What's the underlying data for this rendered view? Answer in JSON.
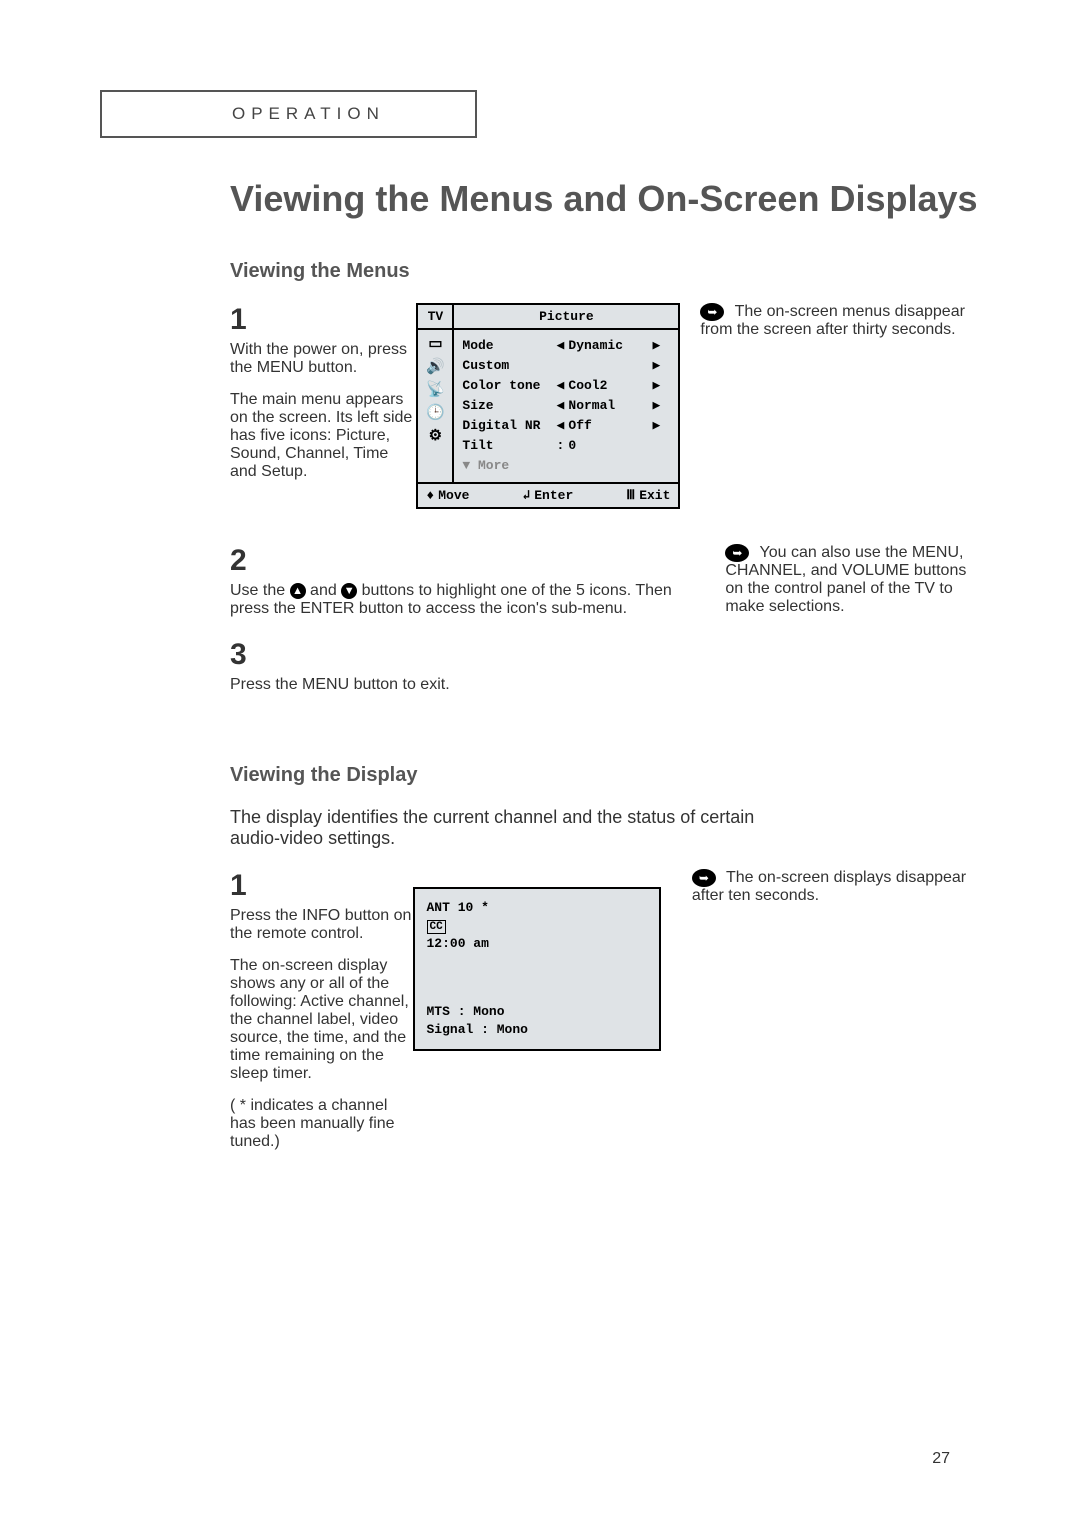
{
  "header": {
    "operation": "OPERATION"
  },
  "title": "Viewing the Menus and On-Screen Displays",
  "menus": {
    "heading": "Viewing the Menus",
    "step1": {
      "num": "1",
      "p1a": "With the power on, press",
      "p1b": "the MENU button.",
      "p2": "The main menu appears on the screen. Its left side has five icons: Picture, Sound, Channel, Time and Setup."
    },
    "step2": {
      "num": "2",
      "textA": "Use the ",
      "textB": " and ",
      "textC": " buttons to highlight one of the 5 icons. Then press the ENTER button to access the icon's sub-menu."
    },
    "step3": {
      "num": "3",
      "text": "Press the MENU button to exit."
    },
    "note1": "The on-screen menus disappear from the screen after thirty seconds.",
    "note2": "You can also use the MENU, CHANNEL, and VOLUME buttons on the control panel of the TV to make selections."
  },
  "osd_picture": {
    "tv": "TV",
    "title": "Picture",
    "rows": [
      {
        "label": "Mode",
        "left": "◀",
        "value": "Dynamic",
        "right": "▶"
      },
      {
        "label": "Custom",
        "left": "",
        "value": "",
        "right": "▶"
      },
      {
        "label": "Color tone",
        "left": "◀",
        "value": "Cool2",
        "right": "▶"
      },
      {
        "label": "Size",
        "left": "◀",
        "value": "Normal",
        "right": "▶"
      },
      {
        "label": "Digital NR",
        "left": "◀",
        "value": "Off",
        "right": "▶"
      },
      {
        "label": "Tilt",
        "left": ":",
        "value": "0",
        "right": ""
      }
    ],
    "more": "▼ More",
    "footer": {
      "move": "Move",
      "enter": "Enter",
      "exit": "Exit"
    }
  },
  "display": {
    "heading": "Viewing the Display",
    "intro": "The display identifies the current channel and the status of certain audio-video settings.",
    "step1": {
      "num": "1",
      "p1": "Press the INFO button on the remote control.",
      "p2": "The on-screen display shows any or all of the following: Active channel, the channel label, video source, the time, and the time remaining on the sleep timer.",
      "p3": "( * indicates a channel has been manually fine tuned.)"
    },
    "note": "The on-screen displays disappear after ten seconds."
  },
  "osd_info": {
    "ant": "ANT   10 *",
    "cc": "CC",
    "time": "12:00 am",
    "mts": "MTS    : Mono",
    "signal": "Signal : Mono"
  },
  "icons": {
    "up": "▲",
    "down": "▼"
  },
  "pagenum": "27"
}
